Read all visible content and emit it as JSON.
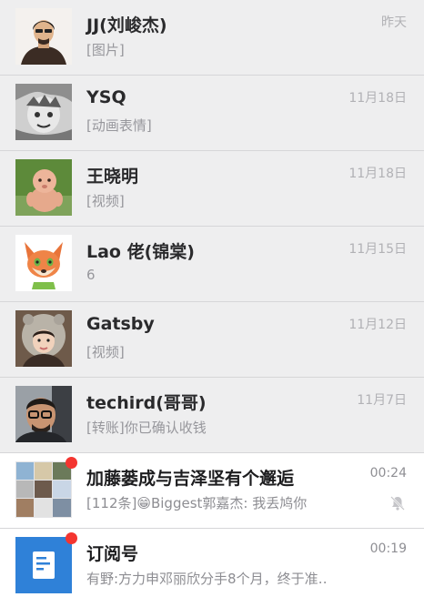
{
  "chats": [
    {
      "name": "JJ(刘峻杰)",
      "preview": "[图片]",
      "time": "昨天",
      "avatar": "man-black-hair-avatar"
    },
    {
      "name": "YSQ",
      "preview": "[动画表情]",
      "time": "11月18日",
      "avatar": "anime-sketch-avatar"
    },
    {
      "name": "王晓明",
      "preview": "[视频]",
      "time": "11月18日",
      "avatar": "baby-photo-avatar"
    },
    {
      "name": "Lao 佬(锦棠)",
      "preview": "6",
      "time": "11月15日",
      "avatar": "fox-cartoon-avatar"
    },
    {
      "name": "Gatsby",
      "preview": "[视频]",
      "time": "11月12日",
      "avatar": "hat-girl-avatar"
    },
    {
      "name": "techird(哥哥)",
      "preview": "[转账]你已确认收钱",
      "time": "11月7日",
      "avatar": "man-glasses-avatar"
    },
    {
      "name": "加藤蒌成与吉泽坚有个邂逅",
      "preview": "[112条]😁Biggest郭嘉杰: 我丢鸠你",
      "time": "00:24",
      "avatar": "group-grid-avatar"
    },
    {
      "name": "订阅号",
      "preview": "有野:方力申邓丽欣分手8个月，终于准‥",
      "time": "00:19",
      "avatar": "subscription-doc-avatar"
    }
  ],
  "colors": {
    "unread_badge": "#f43530",
    "subscription_blue": "#2f81d8"
  }
}
